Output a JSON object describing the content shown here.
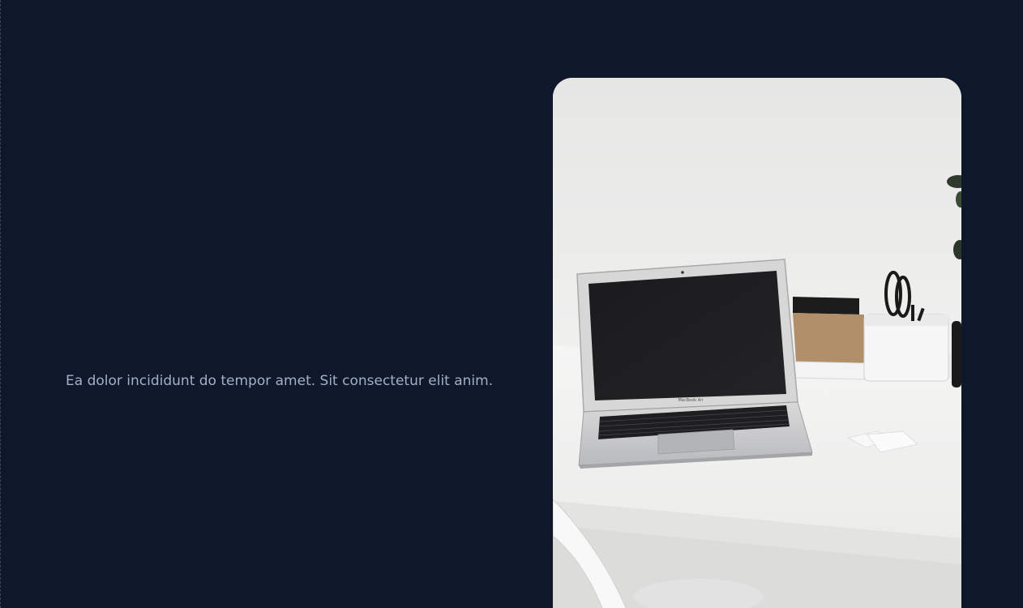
{
  "hero": {
    "tagline": "Ea dolor incididunt do tempor amet. Sit consectetur elit anim."
  },
  "image": {
    "subject": "laptop-on-white-desk",
    "laptop_badge": "MacBook Air"
  },
  "colors": {
    "background": "#0f172a",
    "tagline_text": "#9fb0c7",
    "wall": "#e9e9e8",
    "desk": "#f4f4f3"
  }
}
